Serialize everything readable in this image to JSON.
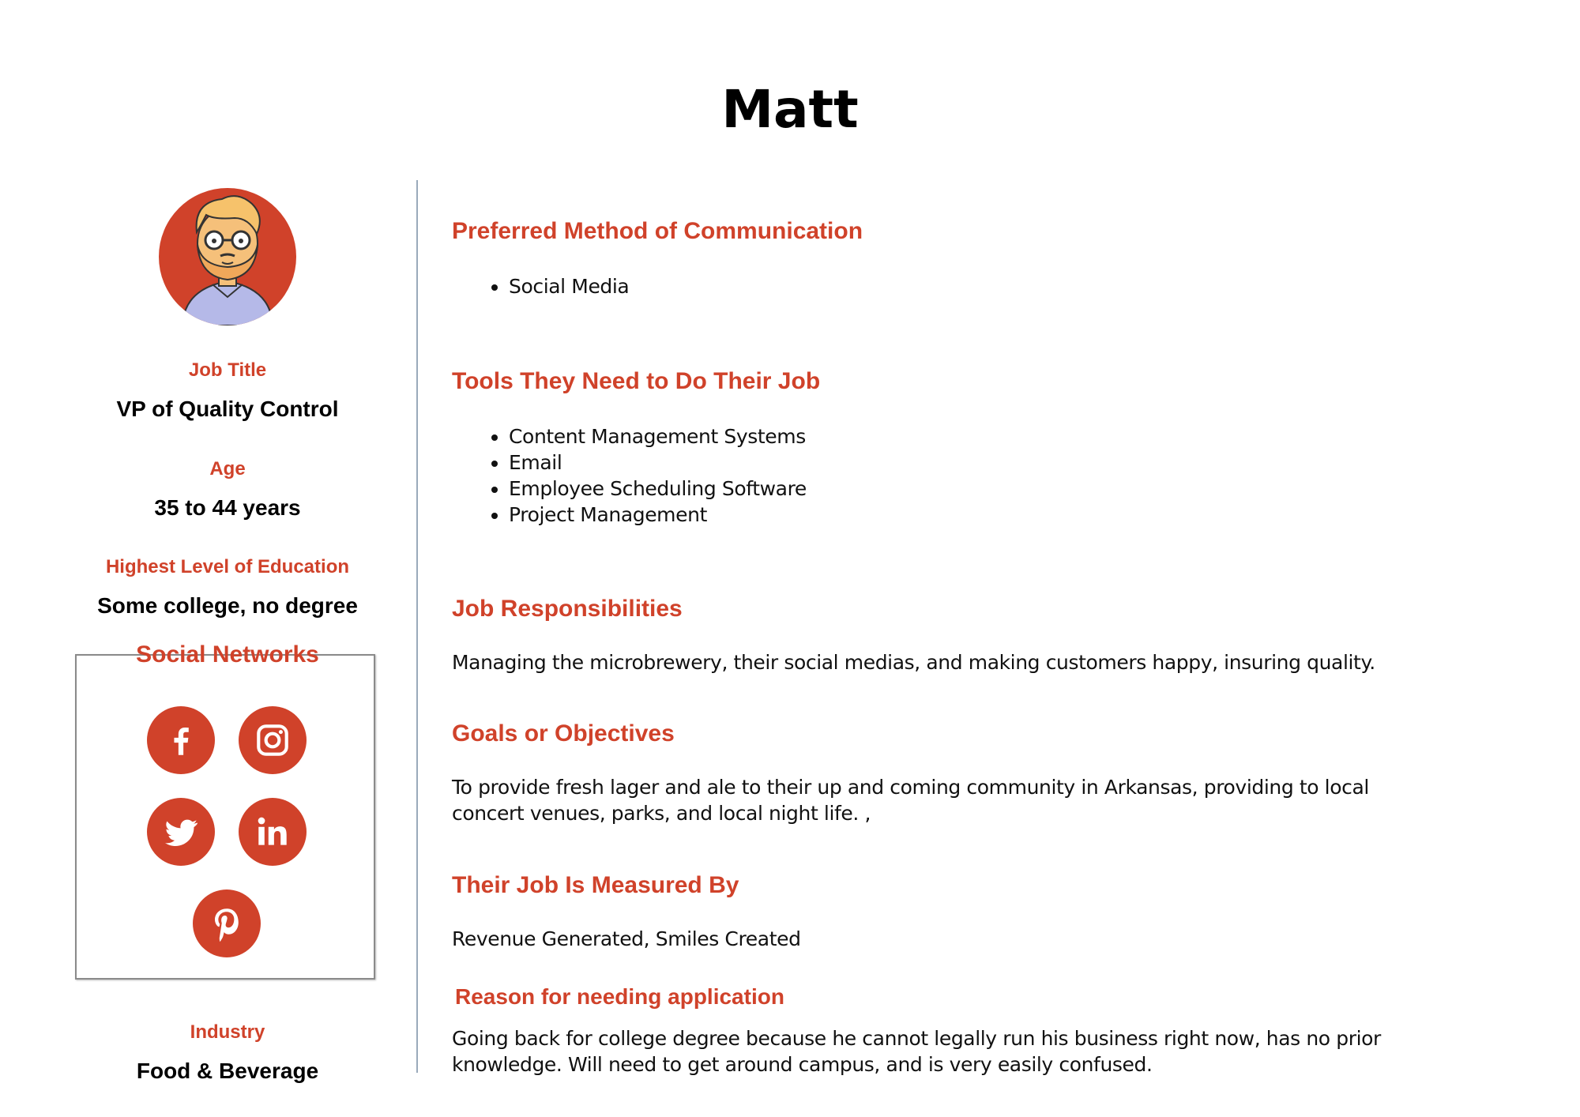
{
  "persona": {
    "name": "Matt",
    "fields": [
      {
        "label": "Job Title",
        "value": "VP of Quality Control"
      },
      {
        "label": "Age",
        "value": "35 to 44 years"
      },
      {
        "label": "Highest Level of Education",
        "value": "Some college, no degree"
      },
      {
        "label": "Industry",
        "value": "Food & Beverage"
      }
    ],
    "social": {
      "title": "Social Networks",
      "icons": [
        "facebook-icon",
        "instagram-icon",
        "twitter-icon",
        "linkedin-icon",
        "pinterest-icon"
      ]
    },
    "accent_color": "#d0422a"
  },
  "sections": {
    "communication": {
      "heading": "Preferred Method of Communication",
      "items": [
        "Social Media"
      ]
    },
    "tools": {
      "heading": "Tools They Need to Do Their Job",
      "items": [
        "Content Management Systems",
        "Email",
        "Employee Scheduling Software",
        "Project Management"
      ]
    },
    "responsibilities": {
      "heading": "Job Responsibilities",
      "text": "Managing the microbrewery, their social medias, and making customers happy, insuring quality."
    },
    "goals": {
      "heading": "Goals or Objectives",
      "text": "To provide fresh lager and ale to their up and coming community in Arkansas, providing to local concert venues, parks, and local night life. ,"
    },
    "measured": {
      "heading": "Their Job Is Measured By",
      "text": "Revenue Generated, Smiles Created"
    },
    "reason": {
      "heading": "Reason for needing application",
      "text": "Going back for college degree because he cannot legally run his business right now, has no prior knowledge. Will need to get around campus, and is very easily confused."
    }
  }
}
